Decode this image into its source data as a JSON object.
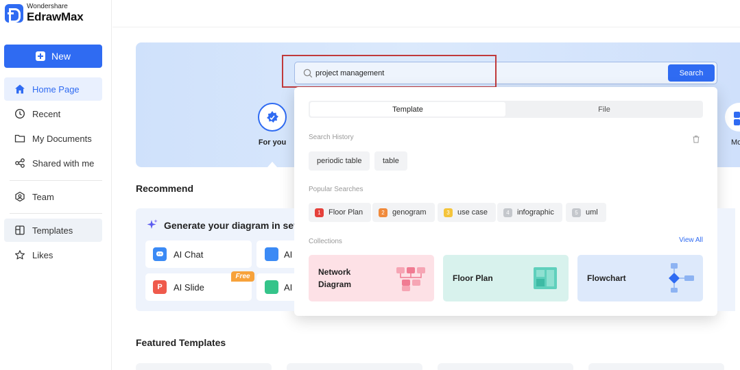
{
  "app": {
    "brand_top": "Wondershare",
    "brand_name": "EdrawMax",
    "accent": "#2f6bf2"
  },
  "sidebar": {
    "new_label": "New",
    "items": [
      {
        "label": "Home Page",
        "icon": "home-icon",
        "active": true
      },
      {
        "label": "Recent",
        "icon": "clock-icon"
      },
      {
        "label": "My Documents",
        "icon": "folder-icon"
      },
      {
        "label": "Shared with me",
        "icon": "share-icon"
      },
      {
        "label": "Team",
        "icon": "team-icon"
      },
      {
        "label": "Templates",
        "icon": "templates-icon"
      },
      {
        "label": "Likes",
        "icon": "star-icon"
      }
    ]
  },
  "hero": {
    "tab_label": "For you",
    "more_label": "Mo"
  },
  "search": {
    "value": "project management",
    "button_label": "Search"
  },
  "dropdown": {
    "tabs": [
      "Template",
      "File"
    ],
    "history_label": "Search History",
    "history": [
      "periodic table",
      "table"
    ],
    "popular_label": "Popular Searches",
    "popular": [
      {
        "rank": "1",
        "label": "Floor Plan",
        "color": "#e5413b"
      },
      {
        "rank": "2",
        "label": "genogram",
        "color": "#f08a3c"
      },
      {
        "rank": "3",
        "label": "use case",
        "color": "#f4c43b"
      },
      {
        "rank": "4",
        "label": "infographic",
        "color": "#c4c7cc"
      },
      {
        "rank": "5",
        "label": "uml",
        "color": "#c4c7cc"
      }
    ],
    "collections_label": "Collections",
    "view_all": "View All",
    "collections": [
      {
        "title_line1": "Network",
        "title_line2": "Diagram",
        "bg": "#fde1e6"
      },
      {
        "title_line1": "Floor Plan",
        "title_line2": "",
        "bg": "#d8f2ed"
      },
      {
        "title_line1": "Flowchart",
        "title_line2": "",
        "bg": "#dde9fb"
      }
    ]
  },
  "recommend": {
    "heading": "Recommend",
    "generate_title": "Generate your diagram in sev",
    "cards": [
      {
        "label": "AI Chat",
        "icon": "ai-chat-icon"
      },
      {
        "label": "AI Slide",
        "icon": "ai-slide-icon",
        "badge": "Free"
      },
      {
        "label": "AI",
        "icon": "ai-user-icon"
      },
      {
        "label": "AI",
        "icon": "ai-table-icon"
      }
    ]
  },
  "featured": {
    "heading": "Featured Templates"
  }
}
